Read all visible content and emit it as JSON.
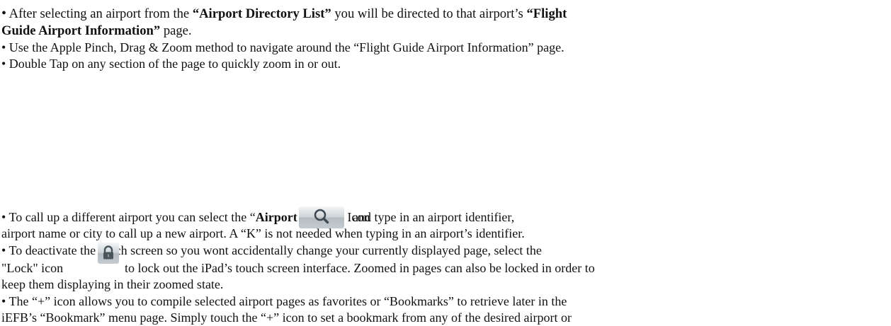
{
  "p1": {
    "bullet": "•",
    "t1": " After selecting an airport from the ",
    "b1": "“Airport Directory List”",
    "t2": " you will be directed to that airport’s ",
    "b2": "“Flight",
    "b3": "Guide Airport Information”",
    "t3": " page."
  },
  "p2": "• Use the Apple Pinch, Drag & Zoom method to navigate around the “Flight Guide Airport Information” page.",
  "p3": "• Double Tap on any section of the page to quickly zoom in or out.",
  "p4": {
    "t1": "• To call up a different airport you can select the “",
    "b1": "Airport Search”",
    "t2": " Icon",
    "t3": "and type in an airport identifier,",
    "line2": "airport name or city to call up a new airport. A “K” is not needed when typing in an airport’s identifier."
  },
  "p5": {
    "line1": "• To deactivate the touch screen so you wont accidentally change your currently displayed page, select the",
    "t1": "\"Lock\" icon",
    "t2": "to lock out the iPad’s touch screen interface. Zoomed in pages can also be locked in order to",
    "line3": "keep them displaying in their zoomed state."
  },
  "p6": {
    "line1": "• The “+” icon allows you to compile selected airport pages as favorites or “Bookmarks” to retrieve later in the",
    "line2": "iEFB’s “Bookmark” menu page. Simply touch the “+” icon to set a bookmark from any of the desired airport or",
    "line3": "chart pages."
  },
  "icons": [
    "search-icon",
    "lock-icon"
  ]
}
